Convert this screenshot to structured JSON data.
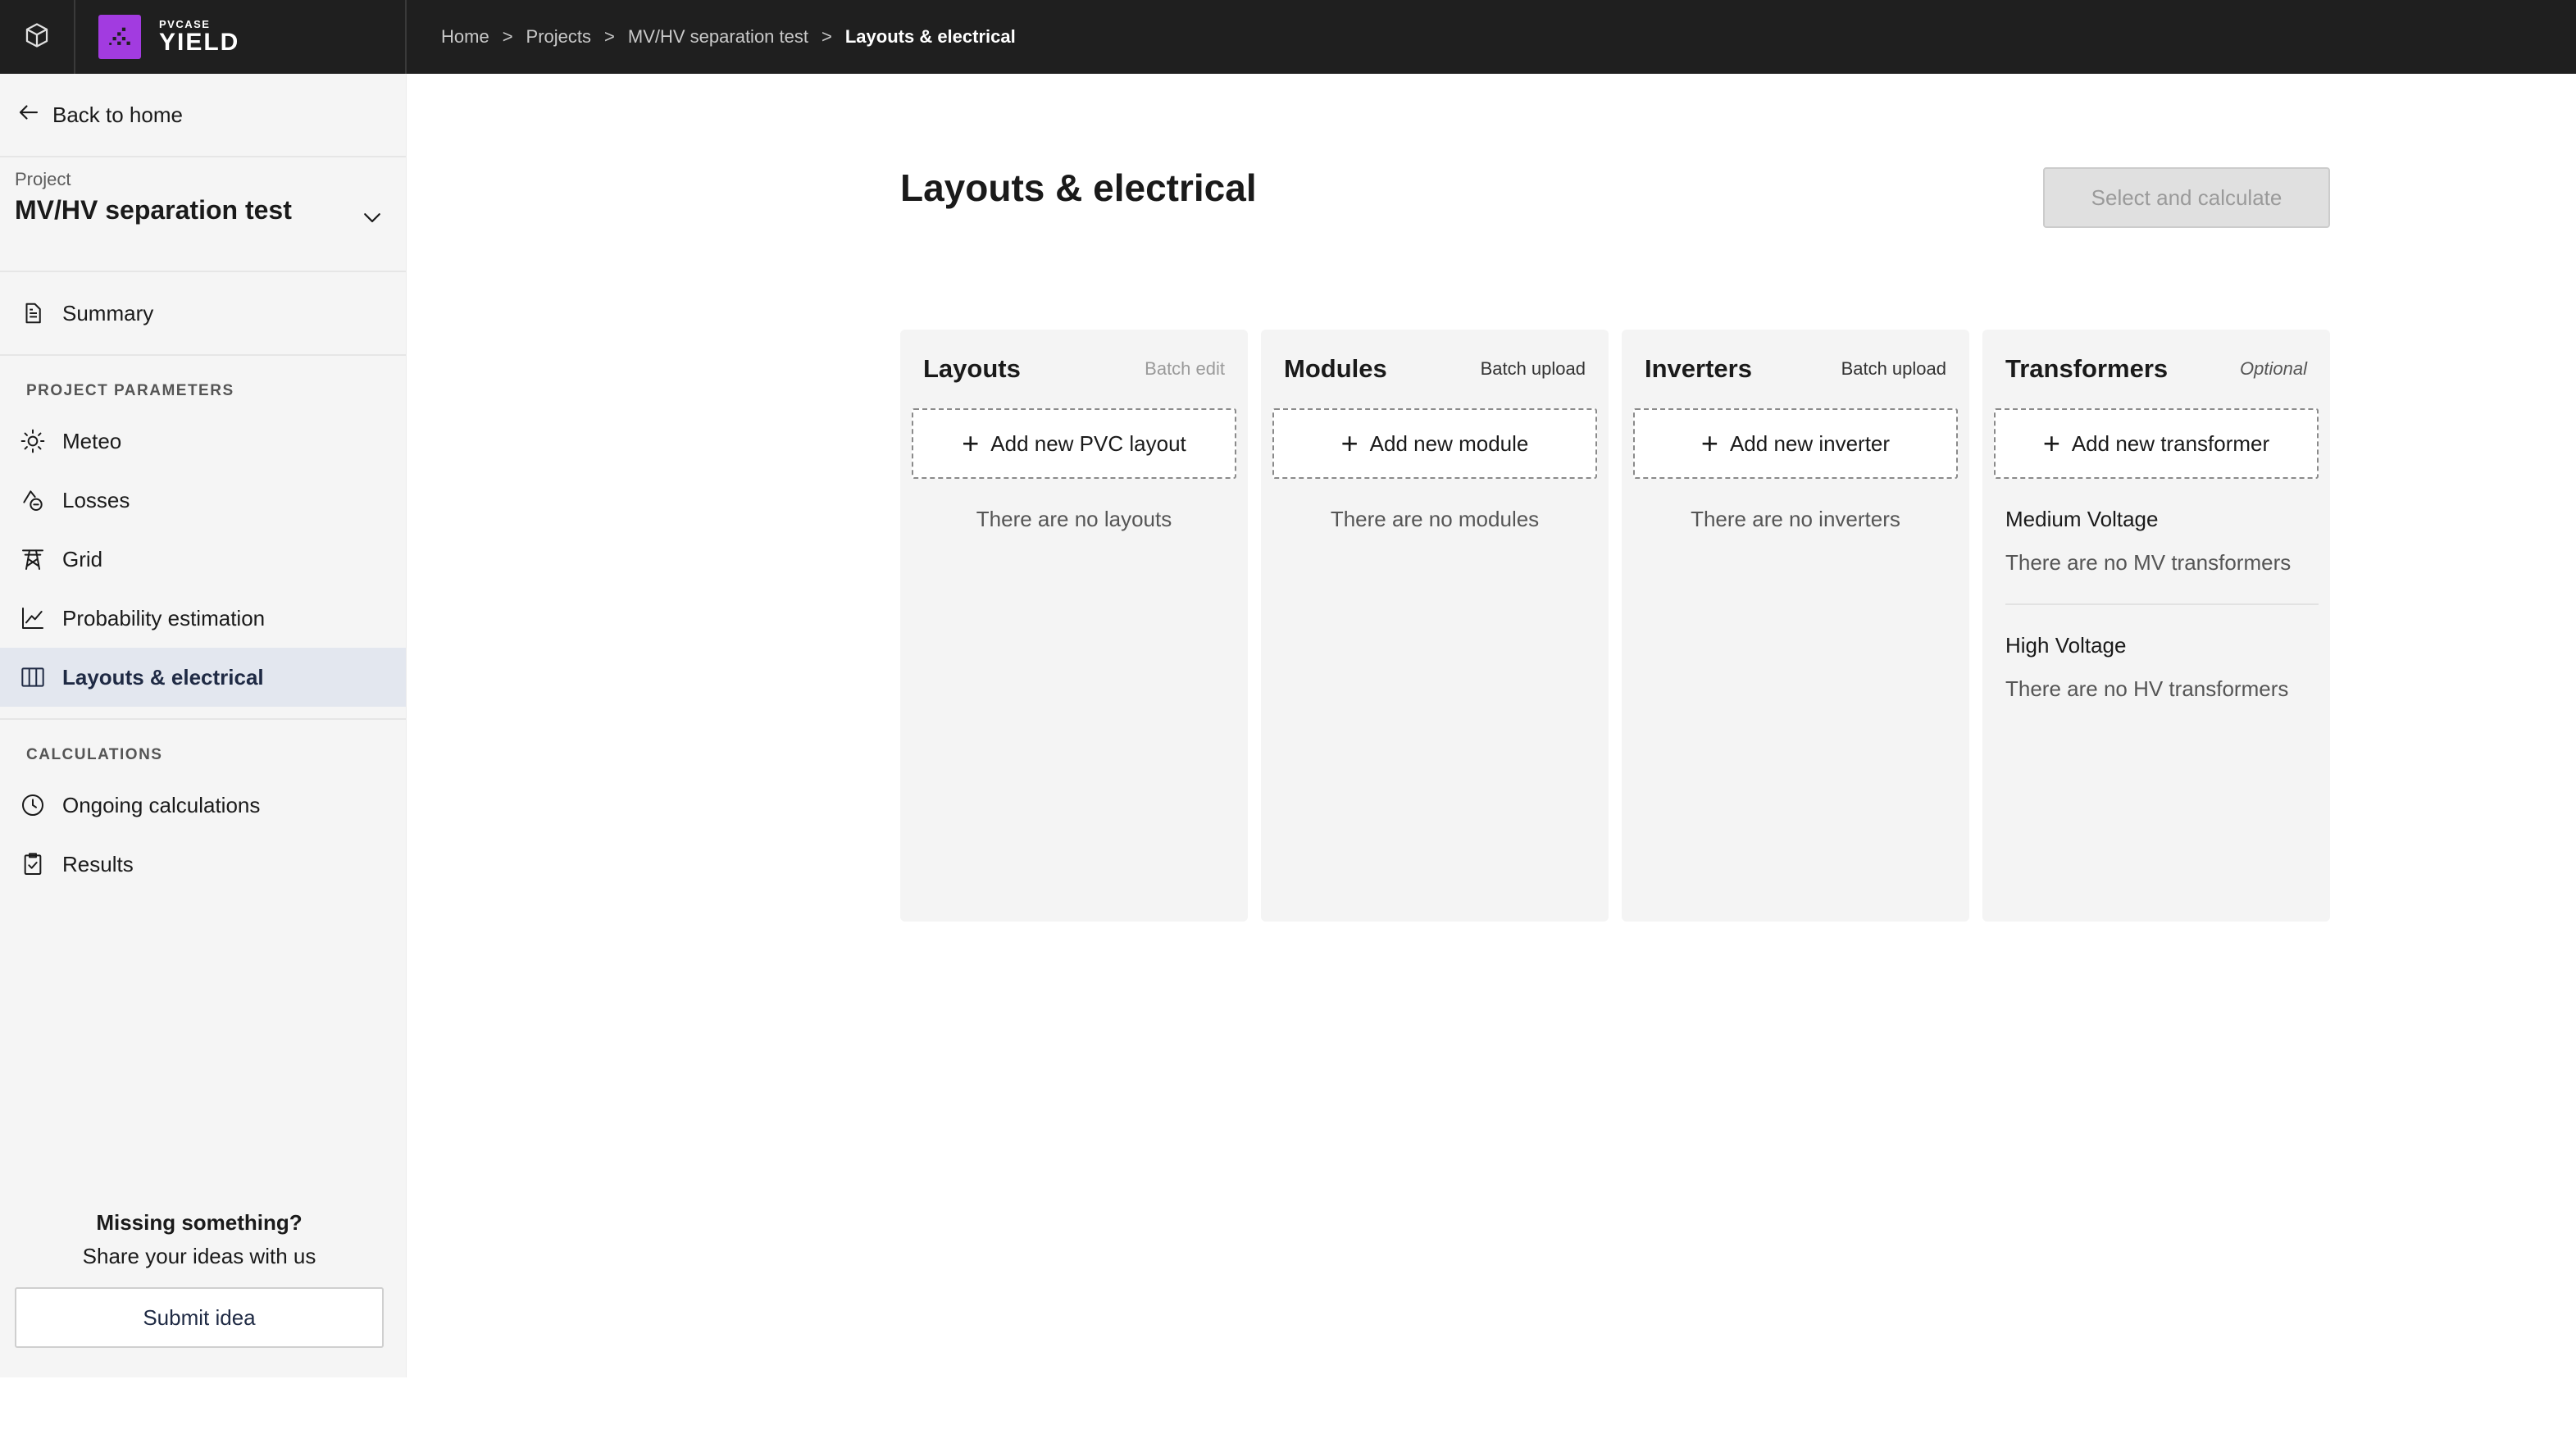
{
  "brand": {
    "small": "PVCASE",
    "big": "YIELD"
  },
  "breadcrumb": {
    "items": [
      "Home",
      "Projects",
      "MV/HV separation test"
    ],
    "current": "Layouts & electrical",
    "separator": ">"
  },
  "sidebar": {
    "back_label": "Back to home",
    "project_label": "Project",
    "project_name": "MV/HV separation test",
    "summary": "Summary",
    "section_params": "PROJECT PARAMETERS",
    "params": [
      "Meteo",
      "Losses",
      "Grid",
      "Probability estimation",
      "Layouts & electrical"
    ],
    "section_calcs": "CALCULATIONS",
    "calcs": [
      "Ongoing calculations",
      "Results"
    ],
    "feedback_title": "Missing something?",
    "feedback_sub": "Share your ideas with us",
    "feedback_button": "Submit idea"
  },
  "main": {
    "title": "Layouts & electrical",
    "calc_button": "Select and calculate",
    "columns": {
      "layouts": {
        "title": "Layouts",
        "action": "Batch edit",
        "add": "Add new PVC layout",
        "empty": "There are no layouts"
      },
      "modules": {
        "title": "Modules",
        "action": "Batch upload",
        "add": "Add new module",
        "empty": "There are no modules"
      },
      "inverters": {
        "title": "Inverters",
        "action": "Batch upload",
        "add": "Add new inverter",
        "empty": "There are no inverters"
      },
      "transformers": {
        "title": "Transformers",
        "action": "Optional",
        "add": "Add new transformer",
        "mv_title": "Medium Voltage",
        "mv_empty": "There are no MV transformers",
        "hv_title": "High Voltage",
        "hv_empty": "There are no HV transformers"
      }
    }
  },
  "colors": {
    "topbar": "#1f1f1f",
    "brand": "#a23be0",
    "active_nav": "#e3e7ef",
    "sidebar": "#f5f5f5"
  },
  "icons": [
    "cube-icon",
    "back-arrow-icon",
    "chevron-down-icon",
    "document-icon",
    "sun-icon",
    "losses-icon",
    "grid-tower-icon",
    "chart-line-icon",
    "columns-icon",
    "clock-icon",
    "clipboard-check-icon",
    "plus-icon"
  ]
}
